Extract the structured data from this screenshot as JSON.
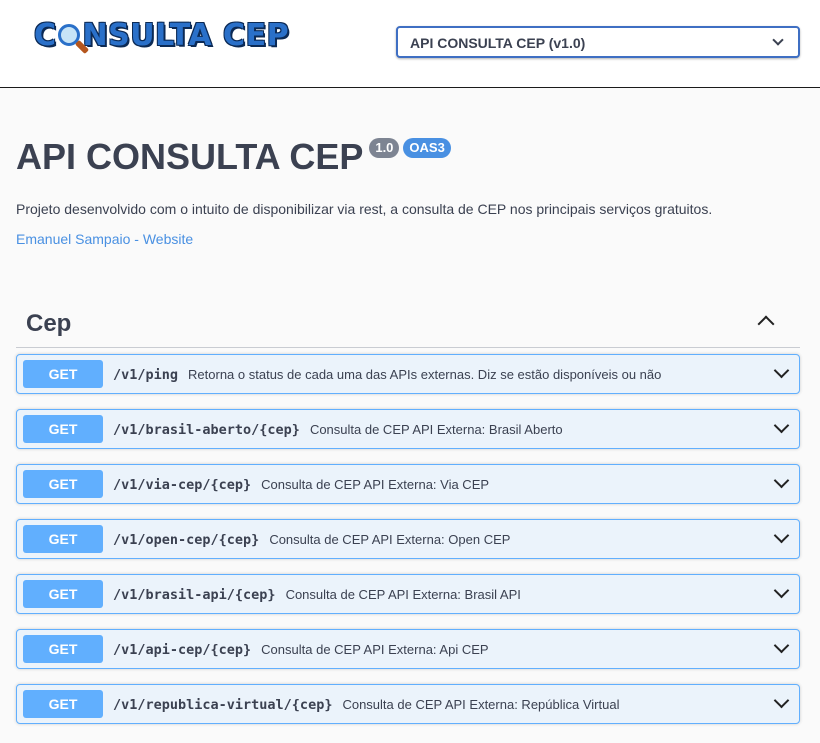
{
  "header": {
    "logo_text": "CONSULTA CEP",
    "logo_parts": {
      "pre": "C",
      "post": "NSULTA CEP"
    },
    "spec_selected": "API CONSULTA CEP (v1.0)"
  },
  "info": {
    "title": "API CONSULTA CEP",
    "version_badge": "1.0",
    "oas_badge": "OAS3",
    "description": "Projeto desenvolvido com o intuito de disponibilizar via rest, a consulta de CEP nos principais serviços gratuitos.",
    "link_text": "Emanuel Sampaio - Website"
  },
  "tag": {
    "name": "Cep"
  },
  "operations": [
    {
      "method": "GET",
      "path": "/v1/ping",
      "summary": "Retorna o status de cada uma das APIs externas. Diz se estão disponíveis ou não"
    },
    {
      "method": "GET",
      "path": "/v1/brasil-aberto/{cep}",
      "summary": "Consulta de CEP API Externa: Brasil Aberto"
    },
    {
      "method": "GET",
      "path": "/v1/via-cep/{cep}",
      "summary": "Consulta de CEP API Externa: Via CEP"
    },
    {
      "method": "GET",
      "path": "/v1/open-cep/{cep}",
      "summary": "Consulta de CEP API Externa: Open CEP"
    },
    {
      "method": "GET",
      "path": "/v1/brasil-api/{cep}",
      "summary": "Consulta de CEP API Externa: Brasil API"
    },
    {
      "method": "GET",
      "path": "/v1/api-cep/{cep}",
      "summary": "Consulta de CEP API Externa: Api CEP"
    },
    {
      "method": "GET",
      "path": "/v1/republica-virtual/{cep}",
      "summary": "Consulta de CEP API Externa: República Virtual"
    }
  ],
  "colors": {
    "get_method": "#61affe",
    "get_background": "#ebf3fb",
    "link": "#4990e2"
  }
}
